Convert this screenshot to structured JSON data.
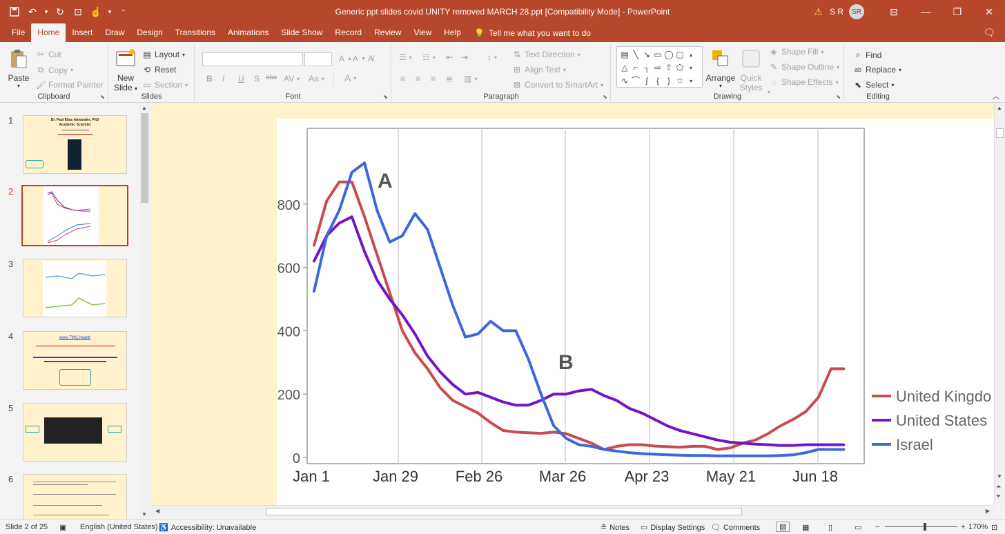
{
  "titlebar": {
    "document_title": "Generic ppt slides covid UNITY removed MARCH 28.ppt [Compatibility Mode]  -  PowerPoint",
    "user_initials": "S R",
    "avatar_initials": "SR"
  },
  "menu": {
    "tabs": [
      "File",
      "Home",
      "Insert",
      "Draw",
      "Design",
      "Transitions",
      "Animations",
      "Slide Show",
      "Record",
      "Review",
      "View",
      "Help"
    ],
    "active_tab": "Home",
    "tell_me": "Tell me what you want to do"
  },
  "ribbon": {
    "clipboard": {
      "label": "Clipboard",
      "paste": "Paste",
      "cut": "Cut",
      "copy": "Copy",
      "format_painter": "Format Painter"
    },
    "slides": {
      "label": "Slides",
      "new_slide_1": "New",
      "new_slide_2": "Slide",
      "layout": "Layout",
      "reset": "Reset",
      "section": "Section"
    },
    "font": {
      "label": "Font",
      "bold": "B",
      "italic": "I",
      "underline": "U",
      "strike": "S",
      "abc": "abc",
      "av": "AV",
      "aa": "Aa",
      "font_color": "A"
    },
    "paragraph": {
      "label": "Paragraph",
      "text_direction": "Text Direction",
      "align_text": "Align Text",
      "convert_smartart": "Convert to SmartArt"
    },
    "drawing": {
      "label": "Drawing",
      "arrange": "Arrange",
      "quick_styles_1": "Quick",
      "quick_styles_2": "Styles",
      "shape_fill": "Shape Fill",
      "shape_outline": "Shape Outline",
      "shape_effects": "Shape Effects"
    },
    "editing": {
      "label": "Editing",
      "find": "Find",
      "replace": "Replace",
      "select": "Select"
    }
  },
  "thumbnails": {
    "numbers": [
      "1",
      "2",
      "3",
      "4",
      "5",
      "6"
    ],
    "active": "2",
    "slide1": {
      "title": "Dr. Paul Elias Alexander, PhD",
      "subtitle": "Academic Scientist"
    },
    "slide4": {
      "link": "www.TWC.health"
    }
  },
  "chart_data": {
    "type": "line",
    "title": "",
    "xlabel": "",
    "ylabel": "",
    "x_ticks": [
      "Jan 1",
      "Jan 29",
      "Feb 26",
      "Mar 26",
      "Apr 23",
      "May 21",
      "Jun 18"
    ],
    "y_ticks": [
      "0",
      "200",
      "400",
      "600",
      "800"
    ],
    "ylim": [
      0,
      950
    ],
    "grid": "vertical",
    "legend_position": "right",
    "annotations": [
      "A",
      "B"
    ],
    "x_days": [
      0,
      4,
      8,
      12,
      16,
      20,
      24,
      28,
      32,
      36,
      40,
      44,
      48,
      52,
      56,
      60,
      64,
      68,
      72,
      76,
      80,
      84,
      88,
      92,
      96,
      100,
      104,
      108,
      112,
      116,
      120,
      124,
      128,
      132,
      136,
      140,
      144,
      148,
      152,
      156,
      160,
      164,
      168,
      172,
      176
    ],
    "series": [
      {
        "name": "United Kingdo",
        "color": "#c94a4f",
        "values": [
          670,
          810,
          870,
          870,
          760,
          640,
          520,
          400,
          330,
          280,
          220,
          180,
          160,
          140,
          110,
          85,
          80,
          78,
          76,
          80,
          75,
          60,
          45,
          25,
          35,
          40,
          40,
          36,
          34,
          32,
          35,
          35,
          25,
          30,
          45,
          55,
          75,
          100,
          120,
          145,
          190,
          280,
          280,
          280,
          280
        ]
      },
      {
        "name": "United States",
        "color": "#7514c7",
        "values": [
          620,
          700,
          740,
          760,
          650,
          560,
          500,
          450,
          390,
          320,
          270,
          230,
          200,
          205,
          190,
          175,
          165,
          165,
          180,
          200,
          200,
          210,
          215,
          195,
          180,
          155,
          140,
          120,
          100,
          85,
          75,
          65,
          55,
          48,
          45,
          42,
          40,
          38,
          38,
          40,
          40,
          40,
          40,
          40,
          40
        ]
      },
      {
        "name": "Israel",
        "color": "#3d68dc",
        "values": [
          525,
          700,
          780,
          900,
          930,
          780,
          680,
          700,
          770,
          720,
          600,
          480,
          380,
          390,
          430,
          400,
          400,
          310,
          200,
          100,
          60,
          40,
          35,
          25,
          20,
          15,
          12,
          10,
          8,
          7,
          6,
          6,
          5,
          5,
          5,
          5,
          5,
          6,
          8,
          15,
          25,
          25,
          25,
          25,
          25
        ]
      }
    ]
  },
  "statusbar": {
    "slide_info": "Slide 2 of 25",
    "language": "English (United States)",
    "accessibility": "Accessibility: Unavailable",
    "notes": "Notes",
    "display_settings": "Display Settings",
    "comments": "Comments",
    "zoom_minus": "−",
    "zoom_plus": "+",
    "zoom_level": "170%"
  }
}
